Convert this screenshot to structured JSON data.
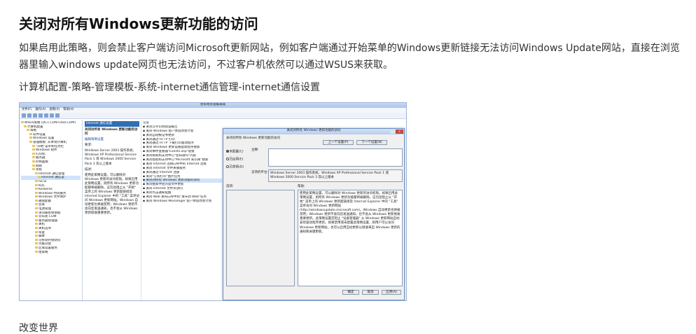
{
  "article": {
    "title": "关闭对所有Windows更新功能的访问",
    "paragraph": "如果启用此策略，则会禁止客户端访问Microsoft更新网站，例如客户端通过开始菜单的Windows更新链接无法访问Windows Update网站，直接在浏览器里输入windows update网页也无法访问，不过客户机依然可以通过WSUS来获取。",
    "path": "计算机配置-策略-管理模板-系统-internet通信管理-internet通信设置",
    "footer": "改变世界"
  },
  "screenshot": {
    "window_title": "组策略管理编辑器",
    "menu": [
      "文件(F)",
      "操作(A)",
      "查看(V)",
      "帮助(H)"
    ],
    "tree": [
      "WSUS策略 [DC1.CONTOSO.COM]",
      "计算机配置",
      "策略",
      "软件设置",
      "Windows 设置",
      "管理模板: 从本地计算机",
      "\"开始\"菜单和任务栏",
      "Windows 组件",
      "打印机",
      "服务器",
      "控制面板",
      "网络",
      "系统",
      "Internet 通信管理",
      "Internet 通信设",
      "iSCSI",
      "KDC",
      "Kerberos",
      "Windows 时间服务",
      "Windows 文件保护",
      "磁盘配额",
      "登录",
      "电源管理",
      "访问被拒绝协助",
      "分布式 COM",
      "服务器管理器",
      "关机",
      "关机选项",
      "恢复",
      "脚本",
      "可移动存储访问",
      "凭据分配",
      "区域设置服务",
      "组策略"
    ],
    "desc_header": "Internet 通信设置",
    "desc_title": "关闭对所有 Windows 更新功能的访问",
    "desc_edit": "编辑策略设置",
    "desc_req_label": "要求:",
    "desc_req": "Windows Server 2003 操作系统、Windows XP Professional Service Pack 1 或 Windows 2000 Service Pack 3 及以上版本",
    "desc_label": "描述:",
    "desc_body": "使用此策略设置，可以删除对 Windows 更新的访问权限。如果启用此策略设置，则所有 Windows 更新功能都将被删除。这包括阻止从 \"开始\" 菜单上的 Windows 更新超链接及 Internet Explorer 中的 \"工具\" 菜单访问 Windows 更新网站。Windows 自动更新也将被禁用；Windows 更新不会向您发送通知，也不会从 Windows 更新接收重要更新。",
    "settings_header": "设置",
    "settings": [
      "关闭汉字识别错误报告",
      "关闭 Windows 客户体验改善计划",
      "关闭自动根证书更新",
      "关闭通过 HTTP 打印",
      "关闭通过 HTTP 下载打印驱动程序",
      "关闭 Windows 更新设备驱动程序搜索",
      "关闭事件查看器\"Events.asp\"链接",
      "关闭帮助和支持中心\"您知道吗\"内容",
      "关闭帮助和支持中心\"Microsoft 知识库\"搜索",
      "关闭 Internet 连接向导中的 Internet 连接",
      "关闭 Internet 文件关联服务",
      "关闭通过 Internet 注册",
      "关闭\"订购打印\"图片任务",
      "关闭对所有 Windows 更新功能的访问",
      "关闭搜索伴侣内容文件更新",
      "关闭 Internet 文件夹访问",
      "关闭点击通知提醒",
      "关闭 Web 发布向导中的\"发布到 Web\"任务",
      "关闭 Windows Messenger 客户体验改善计划"
    ],
    "settings_highlight_index": 13,
    "dialog": {
      "title": "关闭对所有 Windows 更新功能的访问",
      "header": "关闭对所有 Windows 更新功能的访问",
      "prev_button": "上一个设置(P)",
      "next_button": "下一个设置(N)",
      "radio_not_configured": "未配置(C)",
      "radio_enabled": "已启用(E)",
      "radio_disabled": "已禁用(D)",
      "comment_label": "注释:",
      "supported_label": "支持的平台:",
      "supported_text": "Windows Server 2003 操作系统、Windows XP Professional Service Pack 1 或 Windows 2000 Service Pack 3 及以上版本",
      "options_label": "选项:",
      "help_label": "帮助:",
      "help_text": "使用此策略设置，可以删除对 Windows 更新的访问权限。如果启用此策略设置，则所有 Windows 更新功能都将被删除。这包括阻止从 \"开始\" 菜单上的 Windows 更新超链接及 Internet Explorer 中的 \"工具\" 菜单访问 Windows 更新网站 (http://windowsupdate.microsoft.com)。Windows 自动更新也将被禁用；Windows 更新不会向您发送通知，也不会从 Windows 更新接收重要更新。此策略设置还阻止 \"设备管理器\" 从 Windows 更新网站自动安装驱动程序更新。如果禁用或未配置此策略设置，则用户可以访问 Windows 更新网站，也可以启用自动更新以接收来自 Windows 更新的通知和关键更新。",
      "ok_button": "确定",
      "cancel_button": "取消",
      "apply_button": "应用(A)"
    }
  }
}
